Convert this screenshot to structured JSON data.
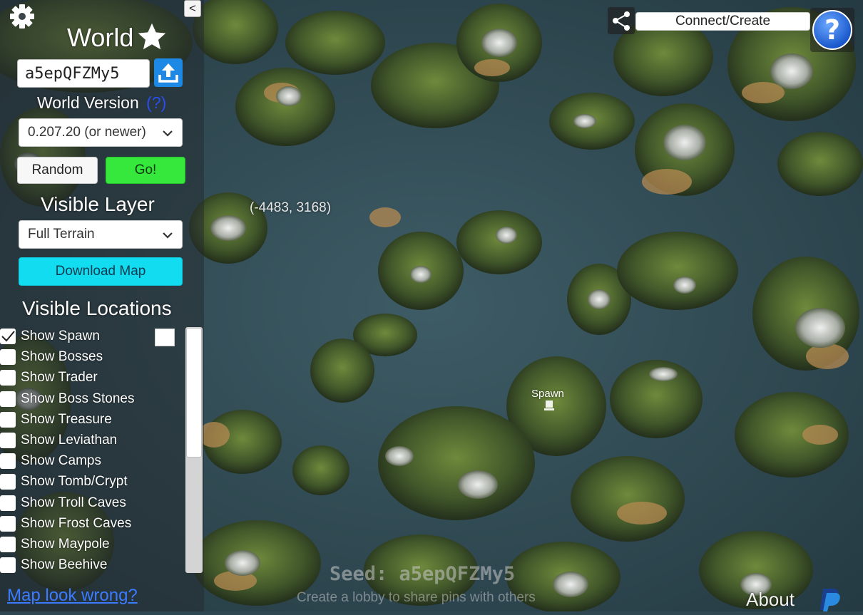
{
  "sidebar": {
    "title": "World",
    "seed_value": "a5epQFZMy5",
    "version_label": "World Version",
    "version_help": "(?)",
    "version_selected": "0.207.20 (or newer)",
    "random_label": "Random",
    "go_label": "Go!",
    "layer_label": "Visible Layer",
    "layer_selected": "Full Terrain",
    "download_label": "Download Map",
    "locations_label": "Visible Locations",
    "locations": [
      {
        "label": "Show Spawn",
        "checked": true
      },
      {
        "label": "Show Bosses",
        "checked": false
      },
      {
        "label": "Show Trader",
        "checked": false
      },
      {
        "label": "Show Boss Stones",
        "checked": false
      },
      {
        "label": "Show Treasure",
        "checked": false
      },
      {
        "label": "Show Leviathan",
        "checked": false
      },
      {
        "label": "Show Camps",
        "checked": false
      },
      {
        "label": "Show Tomb/Crypt",
        "checked": false
      },
      {
        "label": "Show Troll Caves",
        "checked": false
      },
      {
        "label": "Show Frost Caves",
        "checked": false
      },
      {
        "label": "Show Maypole",
        "checked": false
      },
      {
        "label": "Show Beehive",
        "checked": false
      }
    ],
    "map_wrong_link": "Map look wrong?",
    "collapse_label": "<"
  },
  "map": {
    "coordinates": "(-4483, 3168)",
    "spawn_label": "Spawn",
    "seed_overlay": "Seed: a5epQFZMy5",
    "lobby_hint": "Create a lobby to share pins with others",
    "about_label": "About"
  },
  "topbar": {
    "connect_label": "Connect/Create",
    "help_label": "?"
  },
  "colors": {
    "go_button": "#35e83b",
    "download_button": "#12dcef",
    "upload_icon": "#1e88e5",
    "help_icon": "#1f6fe0",
    "link": "#3b7bff"
  }
}
